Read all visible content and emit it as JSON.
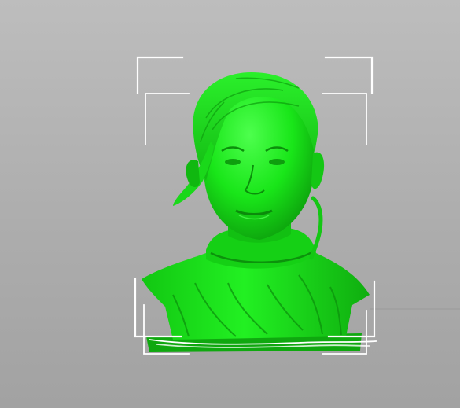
{
  "viewport": {
    "background_top": "#bdbdbd",
    "background_bottom": "#a2a2a2"
  },
  "model": {
    "subject": "bust-sculpture",
    "color": "#19e619",
    "shadow_color": "#0e9a0e",
    "highlight_color": "#5cff5c",
    "selected": true
  },
  "selection_box": {
    "color": "#ffffff",
    "icon": "bounding-box-corners"
  }
}
